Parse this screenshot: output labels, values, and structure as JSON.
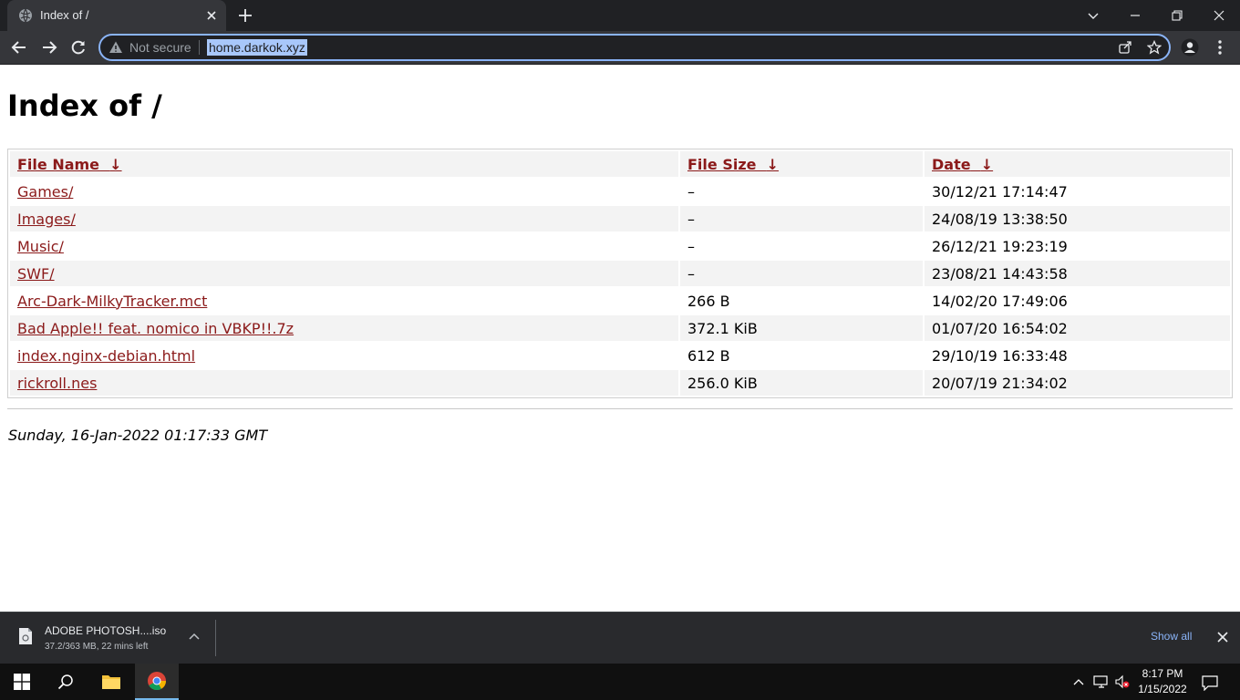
{
  "browser": {
    "tab_title": "Index of /",
    "security_label": "Not secure",
    "url": "home.darkok.xyz"
  },
  "page": {
    "heading": "Index of /",
    "columns": {
      "name": "File Name",
      "size": "File Size",
      "date": "Date",
      "sort_arrow": "↓"
    },
    "rows": [
      {
        "name": "Games/",
        "size": "–",
        "date": "30/12/21 17:14:47"
      },
      {
        "name": "Images/",
        "size": "–",
        "date": "24/08/19 13:38:50"
      },
      {
        "name": "Music/",
        "size": "–",
        "date": "26/12/21 19:23:19"
      },
      {
        "name": "SWF/",
        "size": "–",
        "date": "23/08/21 14:43:58"
      },
      {
        "name": "Arc-Dark-MilkyTracker.mct",
        "size": "266 B",
        "date": "14/02/20 17:49:06"
      },
      {
        "name": "Bad Apple!! feat. nomico in VBKP!!.7z",
        "size": "372.1 KiB",
        "date": "01/07/20 16:54:02"
      },
      {
        "name": "index.nginx-debian.html",
        "size": "612 B",
        "date": "29/10/19 16:33:48"
      },
      {
        "name": "rickroll.nes",
        "size": "256.0 KiB",
        "date": "20/07/19 21:34:02"
      }
    ],
    "footer": "Sunday, 16-Jan-2022 01:17:33 GMT"
  },
  "download": {
    "file_name": "ADOBE PHOTOSH....iso",
    "status": "37.2/363 MB, 22 mins left",
    "show_all": "Show all"
  },
  "taskbar": {
    "time": "8:17 PM",
    "date": "1/15/2022"
  },
  "colors": {
    "link": "#8b1a1a",
    "omnibox_focus": "#8ab4f8",
    "chrome_dark": "#202124"
  }
}
